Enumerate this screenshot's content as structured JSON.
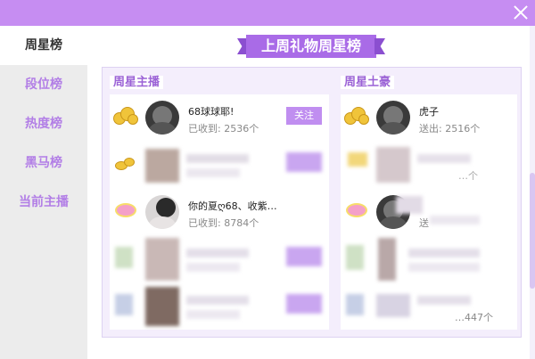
{
  "sidebar": {
    "items": [
      {
        "label": "周星榜",
        "active": true
      },
      {
        "label": "段位榜",
        "active": false
      },
      {
        "label": "热度榜",
        "active": false
      },
      {
        "label": "黑马榜",
        "active": false
      },
      {
        "label": "当前主播",
        "active": false
      }
    ]
  },
  "banner": {
    "title": "上周礼物周星榜"
  },
  "left": {
    "title": "周星主播",
    "rows": [
      {
        "name": "68球球耶!",
        "sub": "已收到: 2536个",
        "follow": "关注"
      },
      {
        "name": "你的夏ღ68、收紫…",
        "sub": "已收到: 8784个"
      }
    ]
  },
  "right": {
    "title": "周星土豪",
    "rows": [
      {
        "name": "虎子",
        "sub": "送出: 2516个"
      },
      {
        "name": "",
        "sub": "送"
      }
    ],
    "partial_row2": "…个",
    "partial_row5": "…447个"
  },
  "colors": {
    "accent": "#c68df2",
    "banner": "#a96be7",
    "text_accent": "#b27ee6"
  }
}
